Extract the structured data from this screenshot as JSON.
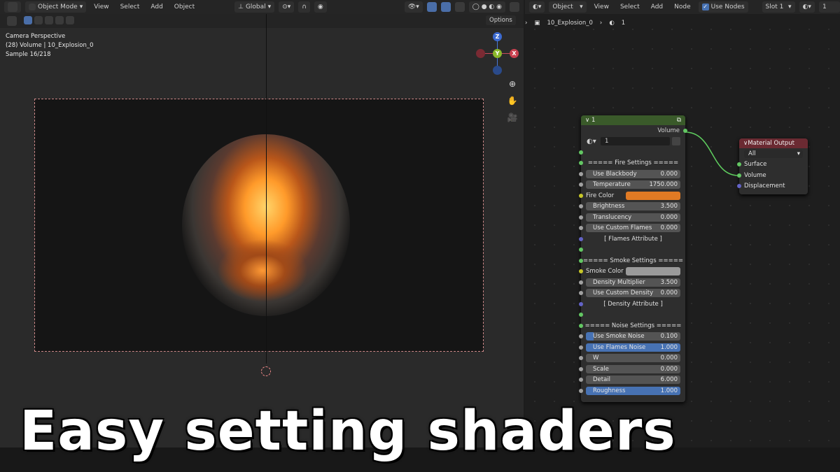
{
  "viewport": {
    "header": {
      "mode": "Object Mode",
      "menus": [
        "View",
        "Select",
        "Add",
        "Object"
      ],
      "transform": "Global"
    },
    "options_label": "Options",
    "overlay": [
      "Camera Perspective",
      "(28) Volume | 10_Explosion_0",
      "Sample 16/218"
    ],
    "gizmo": {
      "z": "Z",
      "y": "Y",
      "x": "X"
    }
  },
  "node_editor": {
    "header": {
      "type": "Object",
      "menus": [
        "View",
        "Select",
        "Add",
        "Node"
      ],
      "use_nodes": "Use Nodes",
      "slot": "Slot 1",
      "material": "1"
    },
    "breadcrumb": {
      "object": "10_Explosion_0",
      "material": "1"
    },
    "group_node": {
      "title": "1",
      "output": "Volume",
      "datablock": "1",
      "rows": [
        {
          "kind": "socket"
        },
        {
          "kind": "heading",
          "text": "=====  Fire  Settings  ====="
        },
        {
          "kind": "field",
          "label": "Use Blackbody",
          "value": "0.000"
        },
        {
          "kind": "field",
          "label": "Temperature",
          "value": "1750.000"
        },
        {
          "kind": "color",
          "label": "Fire Color",
          "color": "#e07a24"
        },
        {
          "kind": "field",
          "label": "Brightness",
          "value": "3.500"
        },
        {
          "kind": "field",
          "label": "Translucency",
          "value": "0.000"
        },
        {
          "kind": "field",
          "label": "Use Custom Flames",
          "value": "0.000"
        },
        {
          "kind": "heading",
          "text": "[ Flames Attribute ]",
          "sock": "p"
        },
        {
          "kind": "socket"
        },
        {
          "kind": "heading",
          "text": "===== Smoke Settings ====="
        },
        {
          "kind": "color",
          "label": "Smoke Color",
          "color": "#9a9a9a"
        },
        {
          "kind": "field",
          "label": "Density Multiplier",
          "value": "3.500"
        },
        {
          "kind": "field",
          "label": "Use Custom Density",
          "value": "0.000"
        },
        {
          "kind": "heading",
          "text": "[ Density Attribute ]",
          "sock": "p"
        },
        {
          "kind": "socket"
        },
        {
          "kind": "heading",
          "text": "=====  Noise Settings  ====="
        },
        {
          "kind": "field",
          "label": "Use Smoke Noise",
          "value": "0.100",
          "partial": true
        },
        {
          "kind": "field",
          "label": "Use Flames Noise",
          "value": "1.000",
          "blue": true
        },
        {
          "kind": "field",
          "label": "W",
          "value": "0.000"
        },
        {
          "kind": "field",
          "label": "Scale",
          "value": "0.000"
        },
        {
          "kind": "field",
          "label": "Detail",
          "value": "6.000"
        },
        {
          "kind": "field",
          "label": "Roughness",
          "value": "1.000",
          "blue": true
        }
      ]
    },
    "material_output": {
      "title": "Material Output",
      "target": "All",
      "inputs": [
        "Surface",
        "Volume",
        "Displacement"
      ]
    }
  },
  "caption": "Easy setting shaders"
}
